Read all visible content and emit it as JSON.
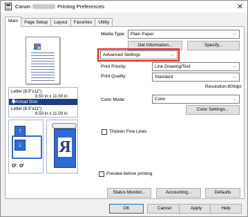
{
  "window": {
    "title_prefix": "Canon",
    "title_suffix": "Printing Preferences",
    "close_label": "✕"
  },
  "tabs": [
    "Main",
    "Page Setup",
    "Layout",
    "Favorites",
    "Utility"
  ],
  "preview": {
    "size_line1": "Letter (8.5\"x11\")",
    "size_line1_dim": "8.50 in x 11.00 in",
    "actual_size_label": "Actual Size",
    "size_line2": "Letter (8.5\"x11\")",
    "size_line2_dim": "8.50 in x 11.00 in",
    "orient_text": "ↄ﻿Ⅽ",
    "r_letter": "R"
  },
  "media": {
    "label": "Media Type:",
    "value": "Plain Paper",
    "get_info_button": "Get Information...",
    "specify_button": "Specify..."
  },
  "advanced": {
    "value": "Advanced Settings"
  },
  "print_priority": {
    "label": "Print Priority:",
    "value": "Line Drawing/Text"
  },
  "print_quality": {
    "label": "Print Quality:",
    "value": "Standard",
    "resolution": "Resolution:600dpi"
  },
  "color_mode": {
    "label": "Color Mode:",
    "value": "Color",
    "settings_button": "Color Settings..."
  },
  "thicken": {
    "label": "Thicken Fine Lines"
  },
  "preview_before_printing": {
    "label": "Preview before printing"
  },
  "bottom_buttons": {
    "status_monitor": "Status Monitor...",
    "accounting": "Accounting...",
    "defaults": "Defaults"
  },
  "dialog_buttons": {
    "ok": "OK",
    "cancel": "Cancel",
    "apply": "Apply",
    "help": "Help"
  },
  "colors": {
    "accent_blue": "#2f6bd6",
    "band_blue": "#1f3e86",
    "highlight_red": "#e41b1b"
  }
}
